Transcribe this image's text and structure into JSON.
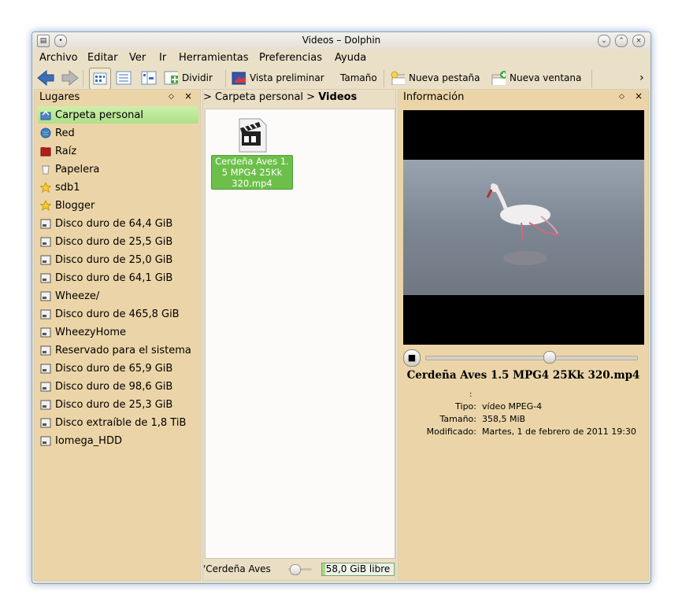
{
  "window": {
    "title": "Videos – Dolphin"
  },
  "menu": [
    "Archivo",
    "Editar",
    "Ver",
    "Ir",
    "Herramientas",
    "Preferencias",
    "Ayuda"
  ],
  "toolbar": {
    "split": "Dividir",
    "preview": "Vista preliminar",
    "size": "Tamaño",
    "new_tab": "Nueva pestaña",
    "new_window": "Nueva ventana",
    "more": "›"
  },
  "places": {
    "title": "Lugares",
    "items": [
      {
        "label": "Carpeta personal",
        "icon": "home-folder-icon"
      },
      {
        "label": "Red",
        "icon": "network-icon"
      },
      {
        "label": "Raíz",
        "icon": "root-folder-icon"
      },
      {
        "label": "Papelera",
        "icon": "trash-icon"
      },
      {
        "label": "sdb1",
        "icon": "star-icon"
      },
      {
        "label": "Blogger",
        "icon": "star-icon"
      },
      {
        "label": "Disco duro de 64,4 GiB",
        "icon": "hard-disk-icon"
      },
      {
        "label": "Disco duro de 25,5 GiB",
        "icon": "hard-disk-icon"
      },
      {
        "label": "Disco duro de 25,0 GiB",
        "icon": "hard-disk-icon"
      },
      {
        "label": "Disco duro de 64,1 GiB",
        "icon": "hard-disk-icon"
      },
      {
        "label": "Wheeze/",
        "icon": "hard-disk-icon"
      },
      {
        "label": "Disco duro de 465,8 GiB",
        "icon": "hard-disk-icon"
      },
      {
        "label": "WheezyHome",
        "icon": "hard-disk-icon"
      },
      {
        "label": "Reservado para el sistema",
        "icon": "hard-disk-icon"
      },
      {
        "label": "Disco duro de 65,9 GiB",
        "icon": "hard-disk-icon"
      },
      {
        "label": "Disco duro de 98,6 GiB",
        "icon": "hard-disk-icon"
      },
      {
        "label": "Disco duro de 25,3 GiB",
        "icon": "hard-disk-icon"
      },
      {
        "label": "Disco extraíble de 1,8 TiB",
        "icon": "hard-disk-icon"
      },
      {
        "label": "Iomega_HDD",
        "icon": "hard-disk-icon"
      }
    ]
  },
  "breadcrumb": {
    "sep": ">",
    "parent": "Carpeta personal",
    "current": "Videos"
  },
  "file": {
    "name": "Cerdeña Aves 1.5 MPG4 25Kk 320.mp4",
    "line1": "Cerdeña Aves 1.",
    "line2": "5 MPG4 25Kk",
    "line3": "320.mp4"
  },
  "status": {
    "selection": "'Cerdeña Aves",
    "free": "58,0 GiB libre"
  },
  "info": {
    "title": "Información",
    "filename": "Cerdeña Aves 1.5 MPG4 25Kk 320.mp4",
    "colon": ":",
    "rows": [
      {
        "key": "Tipo:",
        "value": "vídeo MPEG-4"
      },
      {
        "key": "Tamaño:",
        "value": "358,5 MiB"
      },
      {
        "key": "Modificado:",
        "value": "Martes, 1 de febrero de 2011 19:30"
      }
    ]
  },
  "colors": {
    "selection": "#b6e38f",
    "panel": "#ebd5a8",
    "file_selected": "#6cc04a"
  }
}
